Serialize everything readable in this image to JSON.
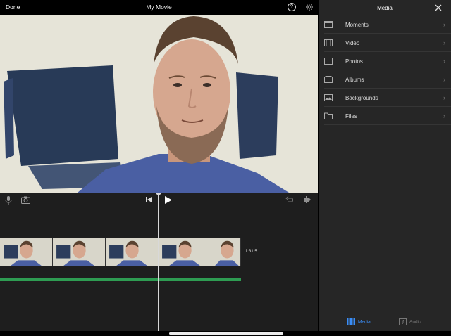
{
  "topbar": {
    "done_label": "Done",
    "title": "My Movie",
    "help_icon": "question-circle-icon",
    "settings_icon": "gear-icon"
  },
  "viewer": {
    "content": "video-preview-frame"
  },
  "timeline": {
    "mic_icon": "microphone-icon",
    "camera_icon": "camera-icon",
    "skip_back_icon": "skip-to-start-icon",
    "play_icon": "play-icon",
    "undo_icon": "undo-icon",
    "waveform_icon": "audio-waveform-icon",
    "clip_duration": "1:31.5",
    "audio_color": "#2e9c52"
  },
  "media_panel": {
    "title": "Media",
    "close_icon": "close-icon",
    "items": [
      {
        "label": "Moments",
        "icon": "moments-icon"
      },
      {
        "label": "Video",
        "icon": "film-icon"
      },
      {
        "label": "Photos",
        "icon": "photo-icon"
      },
      {
        "label": "Albums",
        "icon": "album-icon"
      },
      {
        "label": "Backgrounds",
        "icon": "image-icon"
      },
      {
        "label": "Files",
        "icon": "folder-icon"
      }
    ],
    "tabs": {
      "media": "Media",
      "audio": "Audio"
    },
    "accent_color": "#3a8df7"
  }
}
